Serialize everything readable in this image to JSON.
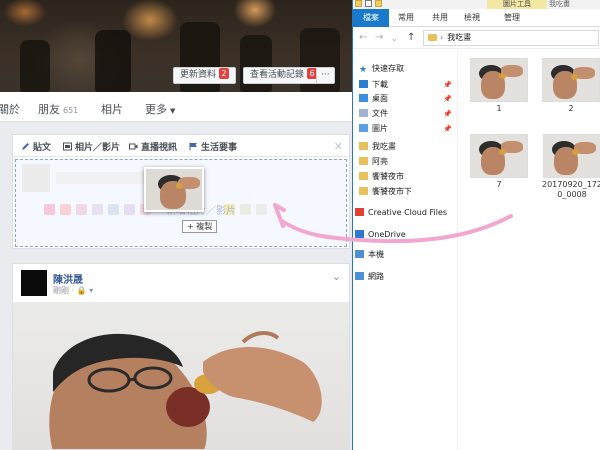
{
  "facebook": {
    "cover_buttons": [
      {
        "label": "更新資料",
        "badge": "2"
      },
      {
        "label": "查看活動記錄",
        "badge": "6"
      },
      {
        "label": "···"
      }
    ],
    "nav": {
      "about": "關於",
      "friends": "朋友",
      "friends_count": "651",
      "photos": "相片",
      "more": "更多"
    },
    "composer": {
      "tabs": [
        "貼文",
        "相片／影片",
        "直播視訊",
        "生活要事"
      ],
      "drop_hint": "新增相片／影片",
      "copy_label": "+ 複製"
    },
    "post": {
      "author": "陳洪晟",
      "meta": "剛剛 · 🔒 ▾"
    }
  },
  "explorer": {
    "title_tool": "圖片工具",
    "title_window": "我吃畫",
    "ribbon_tabs": [
      "檔案",
      "常用",
      "共用",
      "檢視",
      "管理"
    ],
    "address": "我吃畫",
    "nav_items": [
      {
        "label": "快速存取",
        "icon": "star-icon",
        "pinned": false
      },
      {
        "label": "下載",
        "icon": "download-icon",
        "pinned": true
      },
      {
        "label": "桌面",
        "icon": "desktop-icon",
        "pinned": true
      },
      {
        "label": "文件",
        "icon": "document-icon",
        "pinned": true
      },
      {
        "label": "圖片",
        "icon": "pictures-icon",
        "pinned": true
      },
      {
        "label": "我吃畫",
        "icon": "folder-icon",
        "pinned": false
      },
      {
        "label": "阿亮",
        "icon": "folder-icon",
        "pinned": false
      },
      {
        "label": "饗饕夜市",
        "icon": "folder-icon",
        "pinned": false
      },
      {
        "label": "饗饕夜市下",
        "icon": "folder-icon",
        "pinned": false
      },
      {
        "label": "Creative Cloud Files",
        "icon": "creative-cloud-icon",
        "pinned": false
      },
      {
        "label": "OneDrive",
        "icon": "onedrive-icon",
        "pinned": false
      },
      {
        "label": "本機",
        "icon": "computer-icon",
        "pinned": false
      },
      {
        "label": "網路",
        "icon": "network-icon",
        "pinned": false
      }
    ],
    "files": [
      {
        "name": "1"
      },
      {
        "name": "2"
      },
      {
        "name": "7"
      },
      {
        "name": "20170920_1720_0008"
      }
    ]
  },
  "colors": {
    "fb_link": "#365899",
    "ribbon_active": "#1979ca",
    "arrow": "#f1a7cf"
  }
}
